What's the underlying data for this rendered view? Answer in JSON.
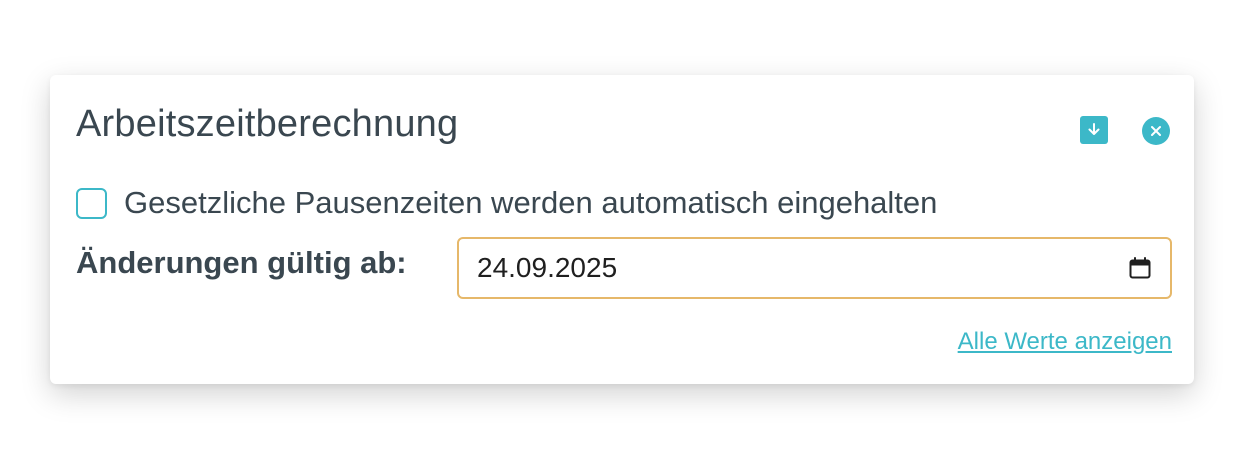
{
  "dialog": {
    "title": "Arbeitszeitberechnung",
    "checkbox_label": "Gesetzliche Pausenzeiten werden automatisch eingehalten",
    "checkbox_checked": false,
    "date_label": "Änderungen gültig ab:",
    "date_value": "24.09.2025",
    "show_all_link": "Alle Werte anzeigen"
  },
  "icons": {
    "save": "download-icon",
    "close": "close-icon",
    "calendar": "calendar-icon"
  },
  "colors": {
    "accent": "#3cb8c8",
    "input_border": "#e6b86a",
    "text": "#3a4750"
  }
}
